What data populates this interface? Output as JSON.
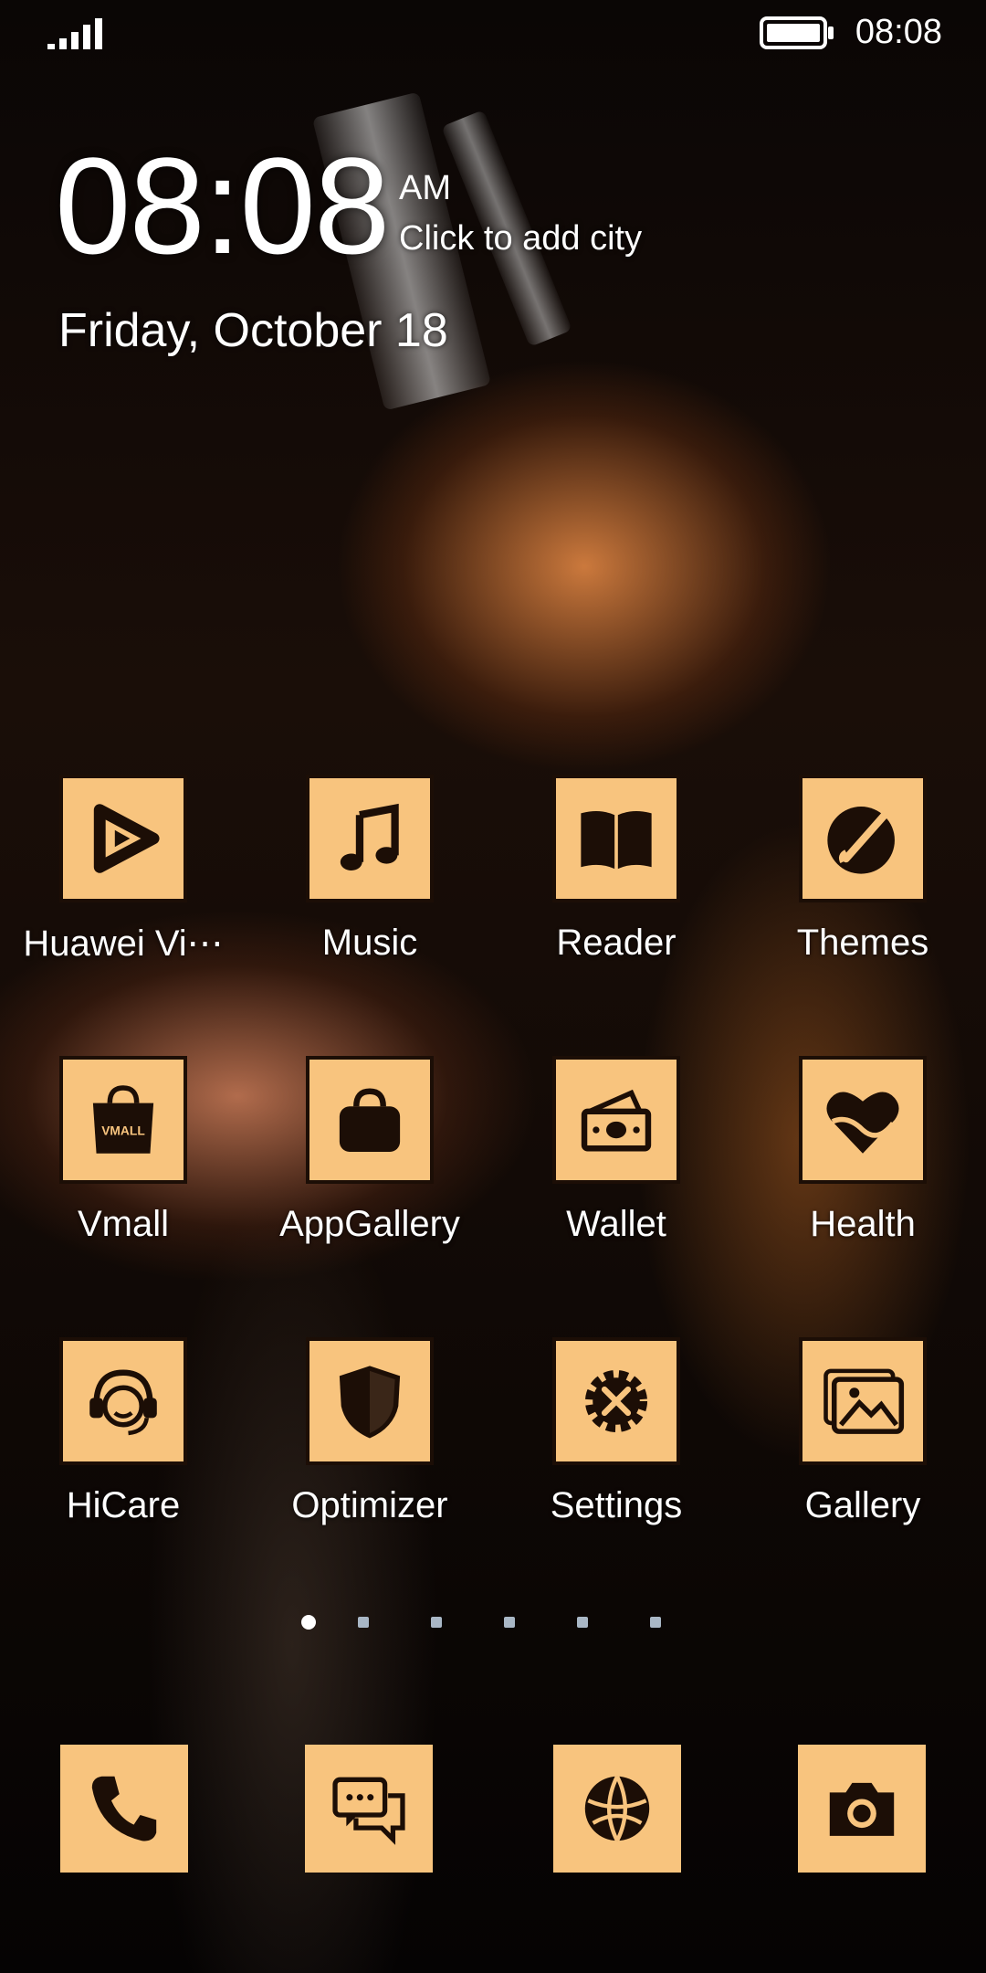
{
  "status_bar": {
    "time": "08:08",
    "signal_icon": "signal-bars-icon",
    "battery_icon": "battery-icon"
  },
  "clock_widget": {
    "time": "08:08",
    "ampm": "AM",
    "city_prompt": "Click to add city",
    "date": "Friday, October 18"
  },
  "apps": [
    {
      "label": "Huawei Vi⋯",
      "icon": "huawei-video-icon"
    },
    {
      "label": "Music",
      "icon": "music-note-icon"
    },
    {
      "label": "Reader",
      "icon": "book-icon"
    },
    {
      "label": "Themes",
      "icon": "paintbrush-icon"
    },
    {
      "label": "Vmall",
      "icon": "vmall-bag-icon",
      "icon_text": "VMALL"
    },
    {
      "label": "AppGallery",
      "icon": "shopping-bag-icon"
    },
    {
      "label": "Wallet",
      "icon": "wallet-cash-icon"
    },
    {
      "label": "Health",
      "icon": "heart-icon"
    },
    {
      "label": "HiCare",
      "icon": "headset-support-icon"
    },
    {
      "label": "Optimizer",
      "icon": "shield-icon"
    },
    {
      "label": "Settings",
      "icon": "gear-tools-icon"
    },
    {
      "label": "Gallery",
      "icon": "photo-icon"
    }
  ],
  "pages": {
    "count": 6,
    "active": 1
  },
  "dock": [
    {
      "name": "phone",
      "icon": "phone-icon"
    },
    {
      "name": "messaging",
      "icon": "chat-icon"
    },
    {
      "name": "browser",
      "icon": "globe-icon"
    },
    {
      "name": "camera",
      "icon": "camera-icon"
    }
  ],
  "colors": {
    "tile": "#f8c47e",
    "icon": "#1c0e06",
    "text": "#ffffff"
  }
}
